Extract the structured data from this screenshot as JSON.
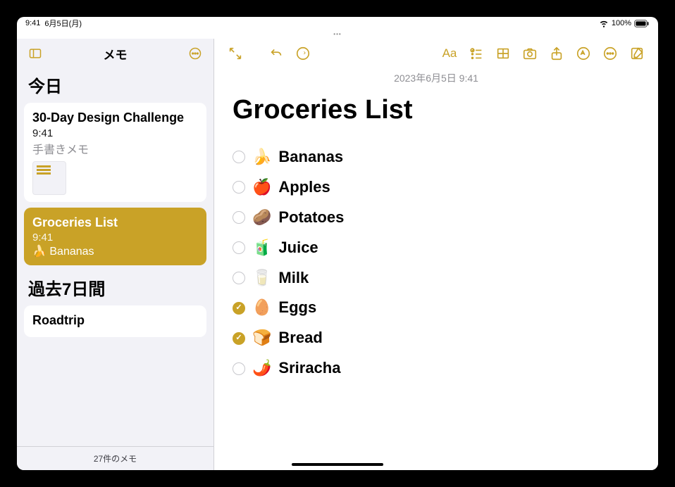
{
  "status": {
    "time": "9:41",
    "date": "6月5日(月)",
    "battery_pct": "100%"
  },
  "sidebar": {
    "title": "メモ",
    "sections": [
      {
        "header": "今日",
        "notes": [
          {
            "title": "30-Day Design Challenge",
            "time": "9:41",
            "subtitle": "手書きメモ",
            "has_thumb": true,
            "selected": false
          },
          {
            "title": "Groceries List",
            "time": "9:41",
            "subtitle": "🍌 Bananas",
            "has_thumb": false,
            "selected": true
          }
        ]
      },
      {
        "header": "過去7日間",
        "notes": [
          {
            "title": "Roadtrip",
            "time": "",
            "subtitle": "",
            "has_thumb": false,
            "selected": false
          }
        ]
      }
    ],
    "footer": "27件のメモ"
  },
  "editor": {
    "date": "2023年6月5日 9:41",
    "title": "Groceries List",
    "items": [
      {
        "emoji": "🍌",
        "label": "Bananas",
        "checked": false
      },
      {
        "emoji": "🍎",
        "label": "Apples",
        "checked": false
      },
      {
        "emoji": "🥔",
        "label": "Potatoes",
        "checked": false
      },
      {
        "emoji": "🧃",
        "label": "Juice",
        "checked": false
      },
      {
        "emoji": "🥛",
        "label": "Milk",
        "checked": false
      },
      {
        "emoji": "🥚",
        "label": "Eggs",
        "checked": true
      },
      {
        "emoji": "🍞",
        "label": "Bread",
        "checked": true
      },
      {
        "emoji": "🌶️",
        "label": "Sriracha",
        "checked": false
      }
    ]
  },
  "icons": {
    "sidebar_toggle": "sidebar-toggle",
    "more": "more",
    "expand": "expand",
    "undo": "undo",
    "redo": "redo",
    "text_style": "Aa",
    "checklist": "checklist",
    "table": "table",
    "camera": "camera",
    "share": "share",
    "markup": "markup",
    "ellipsis": "more",
    "compose": "compose"
  },
  "colors": {
    "accent": "#c9a227",
    "sidebar_bg": "#f2f2f7"
  }
}
